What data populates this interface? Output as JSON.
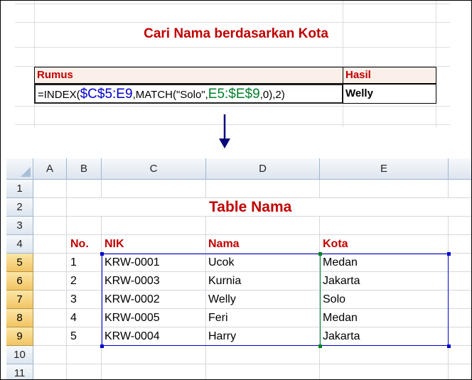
{
  "top": {
    "title": "Cari Nama berdasarkan Kota",
    "rumus_label": "Rumus",
    "hasil_label": "Hasil",
    "formula": {
      "p1": "=INDEX(",
      "p2": "$C$5:E9",
      "p3": ",MATCH(\"Solo\",",
      "p4": "E5:$E$9",
      "p5": ",0),2)"
    },
    "result": "Welly"
  },
  "sheet": {
    "columns": [
      "A",
      "B",
      "C",
      "D",
      "E"
    ],
    "rows": [
      "1",
      "2",
      "3",
      "4",
      "5",
      "6",
      "7",
      "8",
      "9",
      "10",
      "11"
    ],
    "title": "Table Nama",
    "headers": [
      "No.",
      "NIK",
      "Nama",
      "Kota"
    ],
    "records": [
      [
        "1",
        "KRW-0001",
        "Ucok",
        "Medan"
      ],
      [
        "2",
        "KRW-0003",
        "Kurnia",
        "Jakarta"
      ],
      [
        "3",
        "KRW-0002",
        "Welly",
        "Solo"
      ],
      [
        "4",
        "KRW-0005",
        "Feri",
        "Medan"
      ],
      [
        "5",
        "KRW-0004",
        "Harry",
        "Jakarta"
      ]
    ]
  },
  "colors": {
    "accent_red": "#c00000",
    "range_blue": "#0000cc",
    "range_green": "#00802b",
    "header_fill": "#fbefe9",
    "active_header": "#f2c463"
  },
  "icons": {
    "arrow": "arrow-down-icon"
  }
}
